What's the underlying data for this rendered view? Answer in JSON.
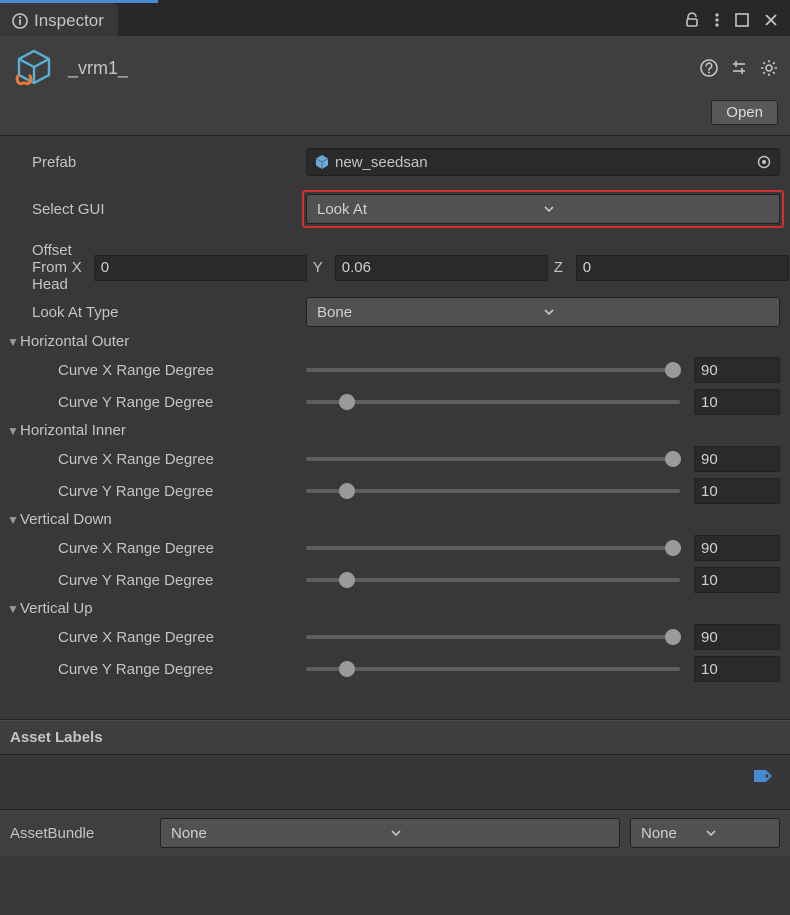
{
  "tab": {
    "title": "Inspector"
  },
  "header": {
    "asset_name": "_vrm1_",
    "open_label": "Open"
  },
  "prefab": {
    "label": "Prefab",
    "value": "new_seedsan"
  },
  "select_gui": {
    "label": "Select GUI",
    "value": "Look At"
  },
  "offset_from_head": {
    "label": "Offset From Head",
    "x_label": "X",
    "x": "0",
    "y_label": "Y",
    "y": "0.06",
    "z_label": "Z",
    "z": "0"
  },
  "look_at_type": {
    "label": "Look At Type",
    "value": "Bone"
  },
  "groups": [
    {
      "title": "Horizontal Outer",
      "curve_x": {
        "label": "Curve X Range Degree",
        "value": "90",
        "pct": 98
      },
      "curve_y": {
        "label": "Curve Y Range Degree",
        "value": "10",
        "pct": 11
      }
    },
    {
      "title": "Horizontal Inner",
      "curve_x": {
        "label": "Curve X Range Degree",
        "value": "90",
        "pct": 98
      },
      "curve_y": {
        "label": "Curve Y Range Degree",
        "value": "10",
        "pct": 11
      }
    },
    {
      "title": "Vertical Down",
      "curve_x": {
        "label": "Curve X Range Degree",
        "value": "90",
        "pct": 98
      },
      "curve_y": {
        "label": "Curve Y Range Degree",
        "value": "10",
        "pct": 11
      }
    },
    {
      "title": "Vertical Up",
      "curve_x": {
        "label": "Curve X Range Degree",
        "value": "90",
        "pct": 98
      },
      "curve_y": {
        "label": "Curve Y Range Degree",
        "value": "10",
        "pct": 11
      }
    }
  ],
  "asset_labels": {
    "header": "Asset Labels"
  },
  "asset_bundle": {
    "label": "AssetBundle",
    "main": "None",
    "variant": "None"
  }
}
